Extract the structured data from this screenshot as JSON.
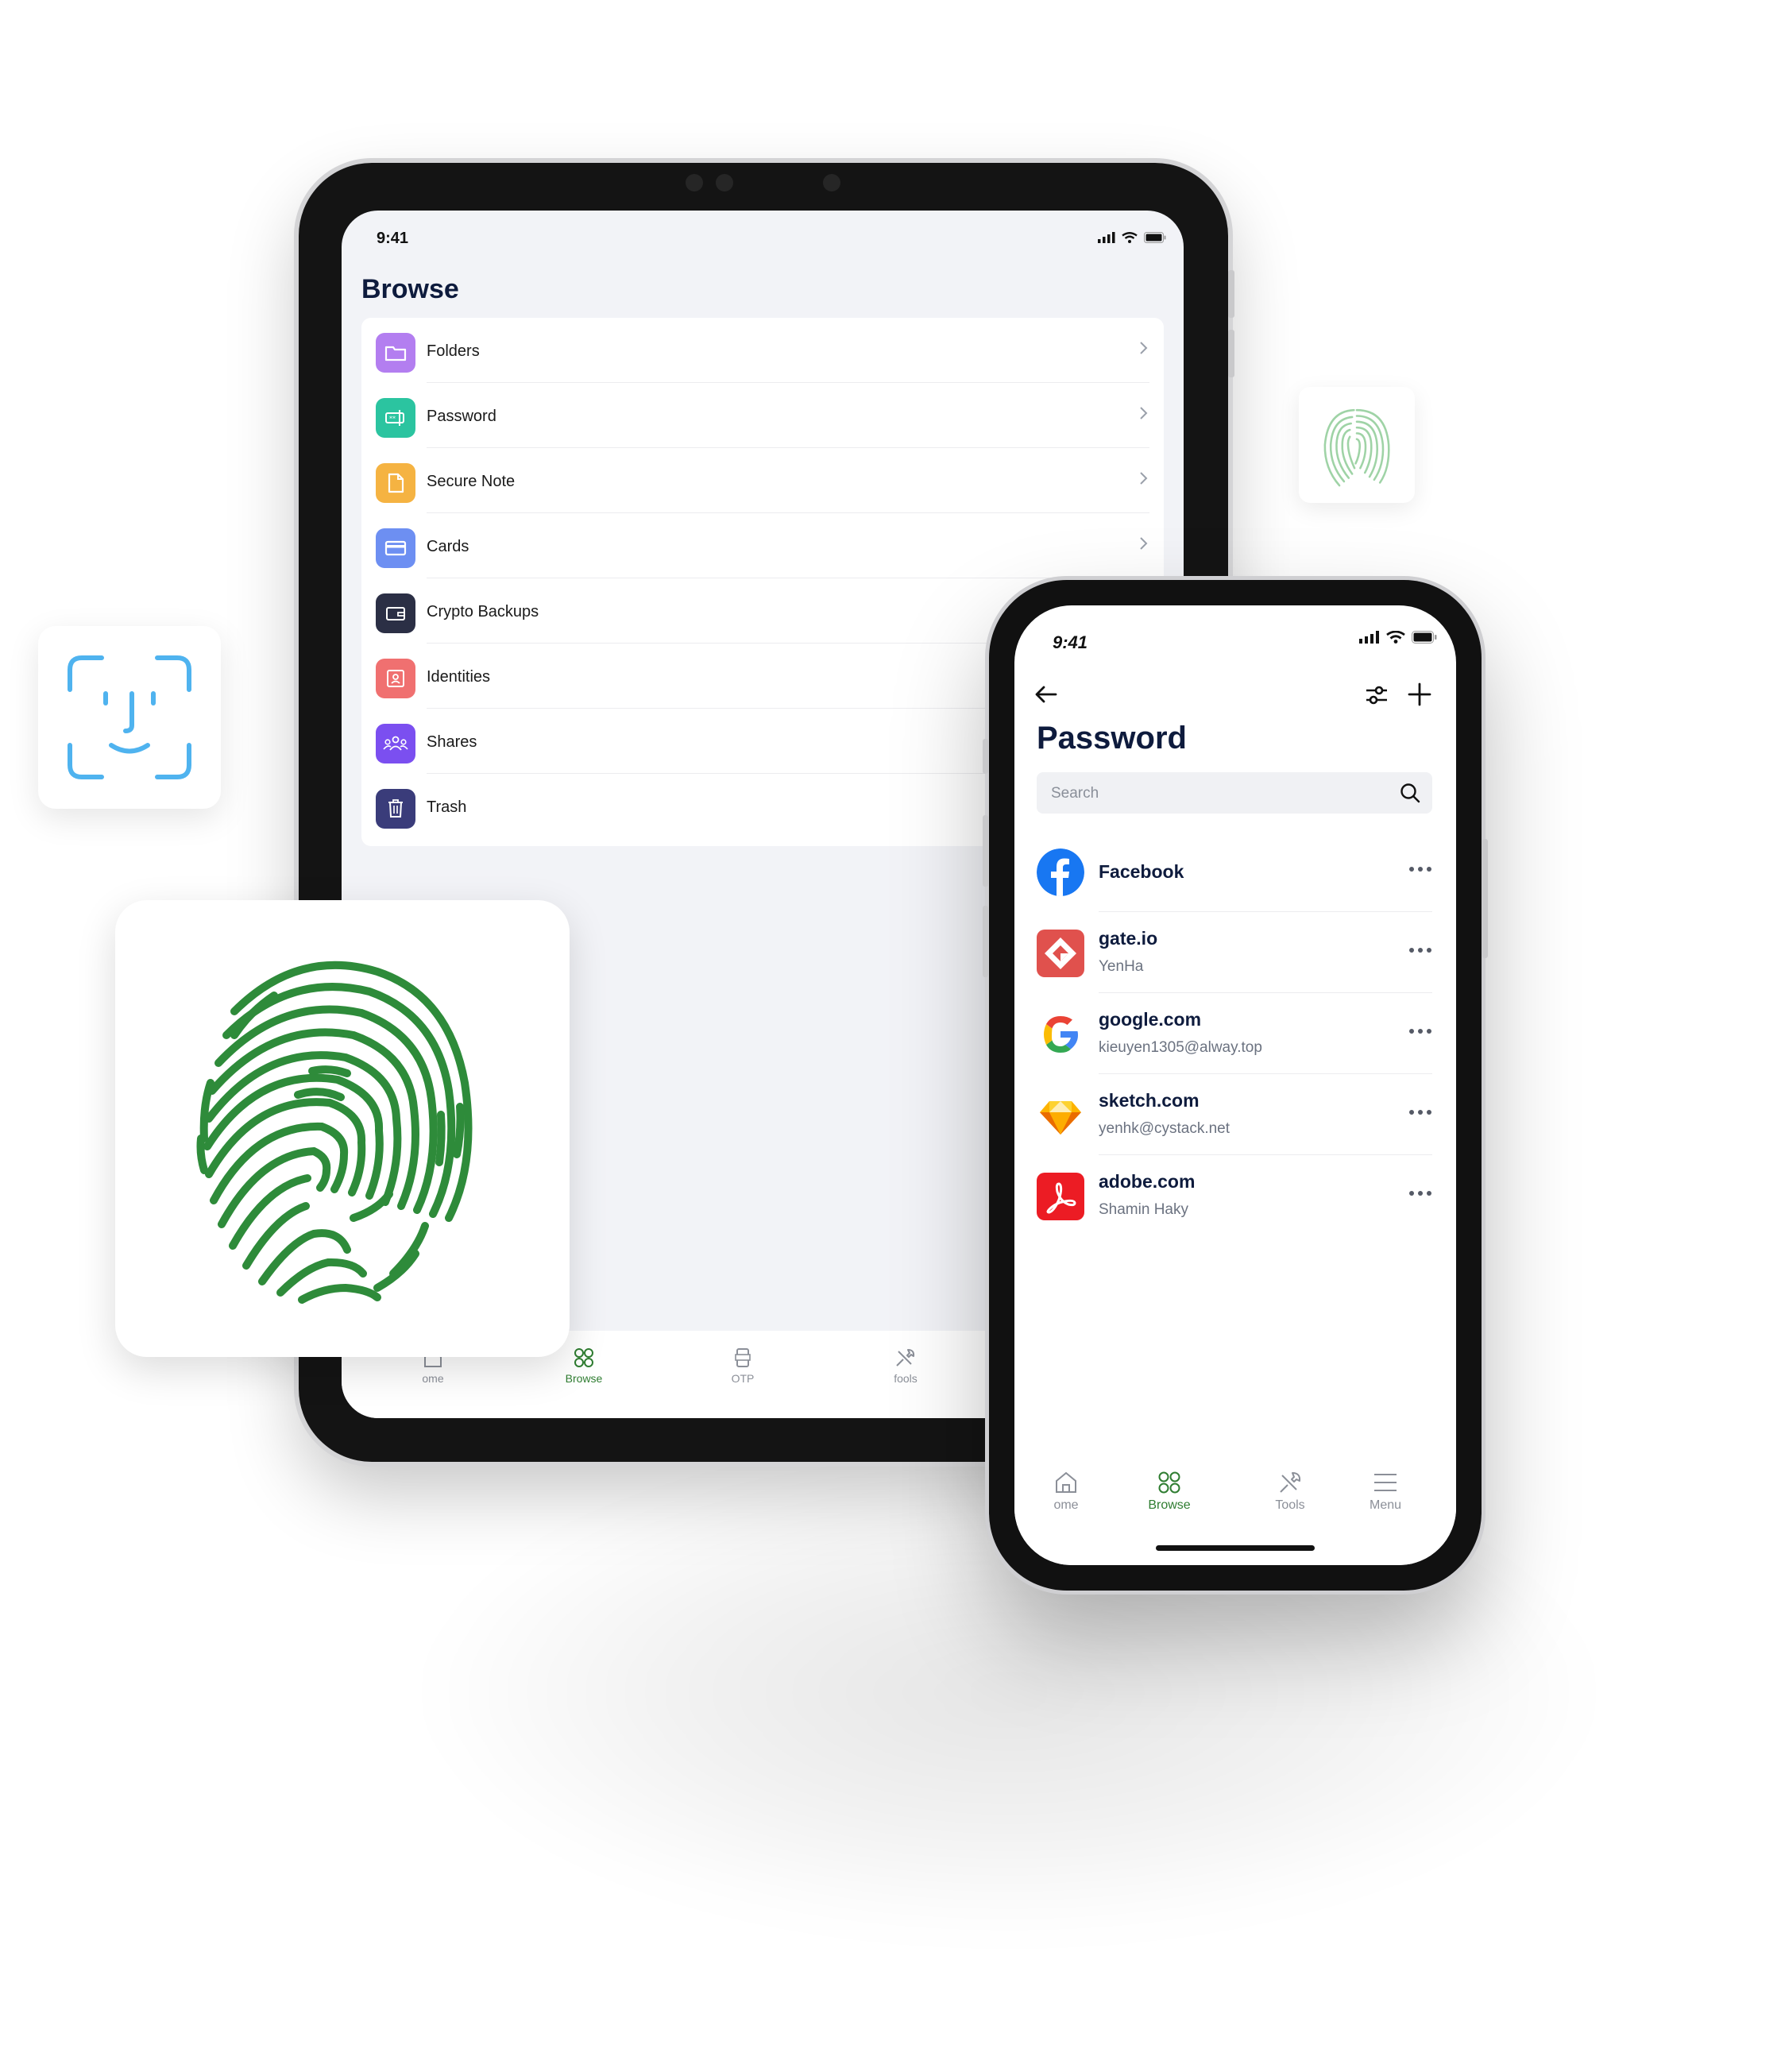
{
  "tablet": {
    "status_time": "9:41",
    "title": "Browse",
    "items": [
      {
        "label": "Folders",
        "icon": "folder-icon",
        "color": "#b37ef0"
      },
      {
        "label": "Password",
        "icon": "password-icon",
        "color": "#2bc4a0"
      },
      {
        "label": "Secure Note",
        "icon": "note-icon",
        "color": "#f5b342"
      },
      {
        "label": "Cards",
        "icon": "card-icon",
        "color": "#6d8ff2"
      },
      {
        "label": "Crypto Backups",
        "icon": "wallet-icon",
        "color": "#2b2f45"
      },
      {
        "label": "Identities",
        "icon": "identity-icon",
        "color": "#f07070"
      },
      {
        "label": "Shares",
        "icon": "shares-icon",
        "color": "#7b4ff0"
      },
      {
        "label": "Trash",
        "icon": "trash-icon",
        "color": "#3a3c7a"
      }
    ],
    "tabs": [
      {
        "label": "ome",
        "icon": "home-icon",
        "active": false
      },
      {
        "label": "Browse",
        "icon": "browse-icon",
        "active": true
      },
      {
        "label": "OTP",
        "icon": "otp-icon",
        "active": false
      },
      {
        "label": "fools",
        "icon": "tools-icon",
        "active": false
      }
    ]
  },
  "phone": {
    "status_time": "9:41",
    "title": "Password",
    "search": {
      "placeholder": "Search"
    },
    "items": [
      {
        "name": "Facebook",
        "sub": "",
        "logo": "facebook-logo"
      },
      {
        "name": "gate.io",
        "sub": "YenHa",
        "logo": "gateio-logo"
      },
      {
        "name": "google.com",
        "sub": "kieuyen1305@alway.top",
        "logo": "google-logo"
      },
      {
        "name": "sketch.com",
        "sub": "yenhk@cystack.net",
        "logo": "sketch-logo"
      },
      {
        "name": "adobe.com",
        "sub": "Shamin Haky",
        "logo": "adobe-logo"
      }
    ],
    "tabs": [
      {
        "label": "ome",
        "icon": "home-icon",
        "active": false
      },
      {
        "label": "Browse",
        "icon": "browse-icon",
        "active": true
      },
      {
        "label": "Tools",
        "icon": "tools-icon",
        "active": false
      },
      {
        "label": "Menu",
        "icon": "menu-icon",
        "active": false
      }
    ]
  },
  "colors": {
    "accent_green": "#2f7d31",
    "fingerprint_green": "#2e8b3a",
    "face_id_blue": "#4fb3ef",
    "title_navy": "#0e1b3d"
  }
}
